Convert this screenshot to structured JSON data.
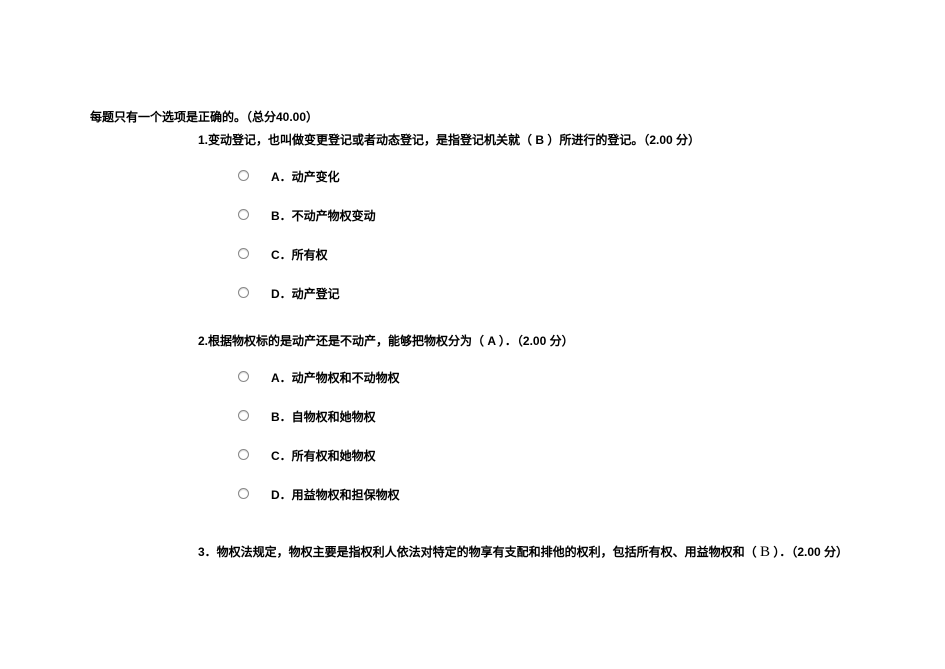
{
  "instruction": "每题只有一个选项是正确的。（总分40.00）",
  "q1": {
    "text": "1.变动登记，也叫做变更登记或者动态登记，是指登记机关就（ B   ）所进行的登记。（2.00 分）",
    "options": {
      "a": "A．动产变化",
      "b": "B．不动产物权变动",
      "c": "C．所有权",
      "d": "D．动产登记"
    }
  },
  "q2": {
    "text": "2.根据物权标的是动产还是不动产，能够把物权分为（ A ）．（2.00 分）",
    "options": {
      "a": "A．动产物权和不动物权",
      "b": "B．自物权和她物权",
      "c": "C．所有权和她物权",
      "d": "D．用益物权和担保物权"
    }
  },
  "q3_prefix": "3．物权法规定，物权主要是指权利人依法对特定的物享有支配和排他的权利，包括所有权、用益物权和（  ",
  "q3_blank": "B",
  "q3_suffix": "    ）．（2.00 分）"
}
